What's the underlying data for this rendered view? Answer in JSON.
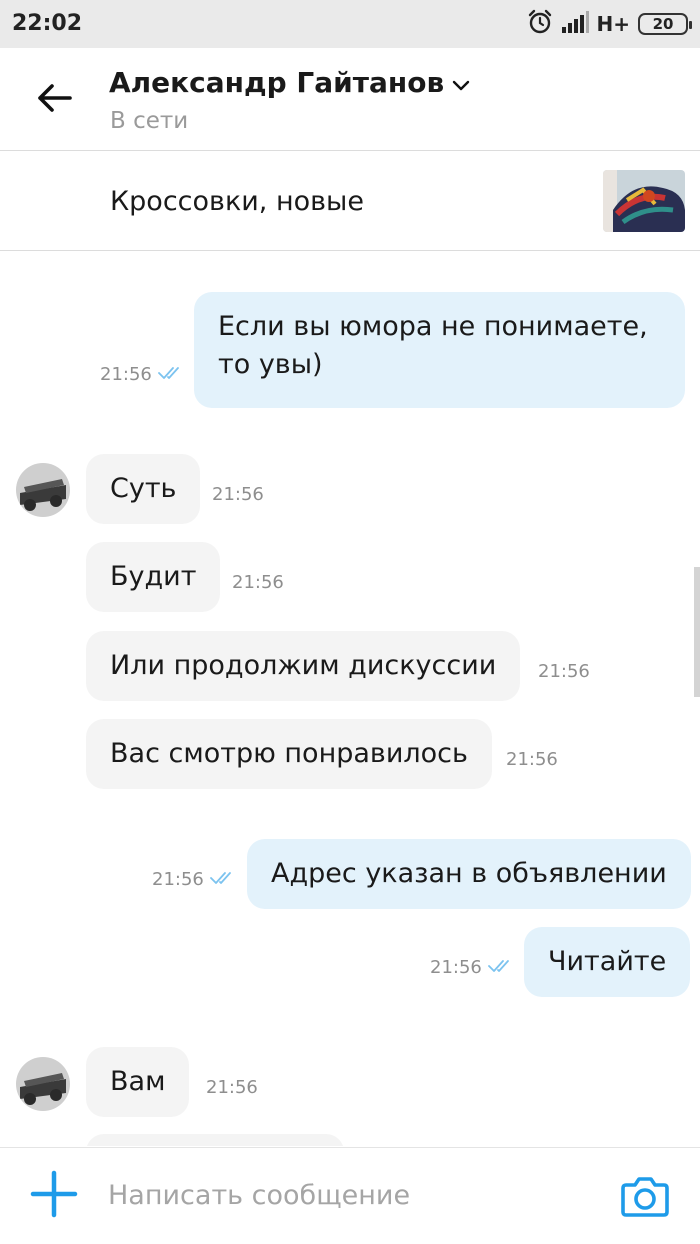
{
  "status_bar": {
    "time": "22:02",
    "network": "H+",
    "battery": "20",
    "icons": [
      "alarm-icon",
      "signal-icon"
    ]
  },
  "header": {
    "contact_name": "Александр Гайтанов",
    "contact_status": "В сети",
    "icons": [
      "back-arrow-icon",
      "chevron-down-icon"
    ]
  },
  "ad": {
    "title": "Кроссовки, новые"
  },
  "messages": [
    {
      "dir": "out",
      "lines": [
        "Если вы юмора не понимаете,",
        "то увы)"
      ],
      "time": "21:56",
      "read": true
    },
    {
      "dir": "in",
      "text": "Суть",
      "time": "21:56",
      "avatar": true
    },
    {
      "dir": "in",
      "text": "Будит",
      "time": "21:56"
    },
    {
      "dir": "in",
      "text": "Или продолжим дискуссии",
      "time": "21:56"
    },
    {
      "dir": "in",
      "text": "Вас смотрю понравилось",
      "time": "21:56"
    },
    {
      "dir": "out",
      "text": "Адрес указан в объявлении",
      "time": "21:56",
      "read": true
    },
    {
      "dir": "out",
      "text": "Читайте",
      "time": "21:56",
      "read": true
    },
    {
      "dir": "in",
      "text": "Вам",
      "time": "21:56",
      "avatar": true
    }
  ],
  "composer": {
    "placeholder": "Написать сообщение",
    "icons": [
      "plus-icon",
      "camera-icon"
    ]
  },
  "colors": {
    "accent": "#1e9be9",
    "outgoing_bubble": "#e3f2fb",
    "incoming_bubble": "#f4f4f4",
    "read_check": "#7cc3ef"
  }
}
